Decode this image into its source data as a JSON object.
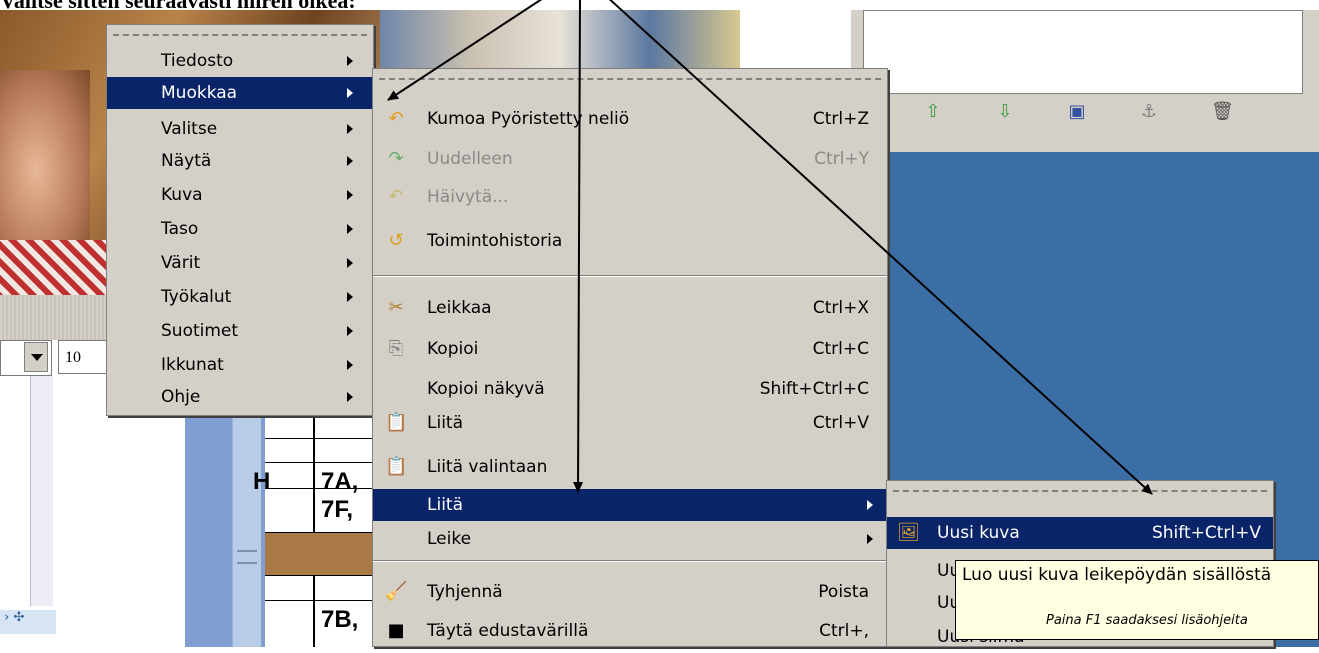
{
  "caption": "Valitse sitten seuraavasti hiiren oikea:",
  "zoom_field": "10",
  "table_cells": [
    "H",
    "7A,",
    "7F,",
    "7B,"
  ],
  "main_menu": [
    {
      "label": "Tiedosto"
    },
    {
      "label": "Muokkaa",
      "selected": true
    },
    {
      "label": "Valitse"
    },
    {
      "label": "Näytä"
    },
    {
      "label": "Kuva"
    },
    {
      "label": "Taso"
    },
    {
      "label": "Värit"
    },
    {
      "label": "Työkalut"
    },
    {
      "label": "Suotimet"
    },
    {
      "label": "Ikkunat"
    },
    {
      "label": "Ohje"
    }
  ],
  "edit_menu": [
    {
      "label": "Kumoa Pyöristetty neliö",
      "shortcut": "Ctrl+Z",
      "icon": "undo-icon"
    },
    {
      "label": "Uudelleen",
      "shortcut": "Ctrl+Y",
      "icon": "redo-icon",
      "disabled": true
    },
    {
      "label": "Häivytä...",
      "shortcut": "",
      "icon": "fade-icon",
      "disabled": true
    },
    {
      "label": "Toimintohistoria",
      "shortcut": "",
      "icon": "history-icon"
    },
    {
      "label": "Leikkaa",
      "shortcut": "Ctrl+X",
      "icon": "cut-icon"
    },
    {
      "label": "Kopioi",
      "shortcut": "Ctrl+C",
      "icon": "copy-icon"
    },
    {
      "label": "Kopioi näkyvä",
      "shortcut": "Shift+Ctrl+C",
      "icon": ""
    },
    {
      "label": "Liitä",
      "shortcut": "Ctrl+V",
      "icon": "paste-icon"
    },
    {
      "label": "Liitä valintaan",
      "shortcut": "",
      "icon": "paste-into-icon"
    },
    {
      "label": "Liitä",
      "shortcut": "",
      "icon": "",
      "selected": true,
      "submenu": true
    },
    {
      "label": "Leike",
      "shortcut": "",
      "icon": "",
      "submenu": true
    },
    {
      "label": "Tyhjennä",
      "shortcut": "Poista",
      "icon": "clear-icon"
    },
    {
      "label": "Täytä edustavärillä",
      "shortcut": "Ctrl+,",
      "icon": "fill-fg-icon"
    }
  ],
  "paste_submenu": [
    {
      "label": "Uusi kuva",
      "shortcut": "Shift+Ctrl+V",
      "icon": "new-image-icon",
      "selected": true
    },
    {
      "label": "Uu",
      "shortcut": ""
    },
    {
      "label": "Uu",
      "shortcut": ""
    },
    {
      "label": "Uusi silmä",
      "shortcut": ""
    }
  ],
  "tooltip": {
    "text": "Luo uusi kuva leikepöydän sisällöstä",
    "hint": "Paina F1 saadaksesi lisäohjeita"
  },
  "colors": {
    "menu_bg": "#d4d0c8",
    "selection": "#0a246a",
    "desktop": "#3a6ea5",
    "tooltip_bg": "#ffffe1"
  }
}
